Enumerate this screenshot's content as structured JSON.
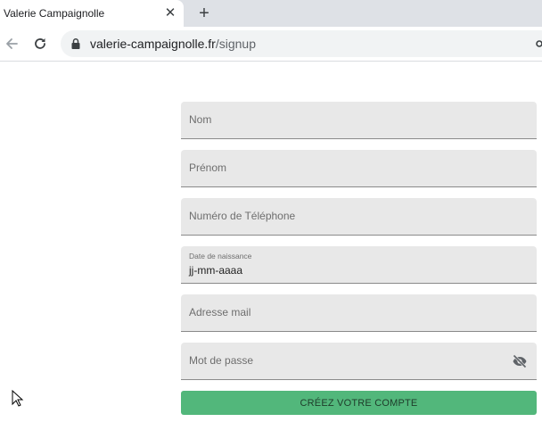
{
  "browser": {
    "tab_title": "Valerie Campaignolle",
    "tab_close": "✕",
    "new_tab": "+",
    "url_host": "valerie-campaignolle.fr",
    "url_path": "/signup"
  },
  "form": {
    "fields": [
      {
        "label": "Nom"
      },
      {
        "label": "Prénom"
      },
      {
        "label": "Numéro de Téléphone"
      },
      {
        "label": "Date de naissance",
        "value": "jj-mm-aaaa"
      },
      {
        "label": "Adresse mail"
      },
      {
        "label": "Mot de passe"
      }
    ],
    "submit_label": "CRÉEZ VOTRE COMPTE"
  },
  "colors": {
    "accent": "#52b77b",
    "field_bg": "#e8e8e8"
  },
  "icons": [
    "back-arrow-icon",
    "reload-icon",
    "lock-icon",
    "key-icon",
    "eye-off-icon",
    "mouse-cursor-icon"
  ]
}
